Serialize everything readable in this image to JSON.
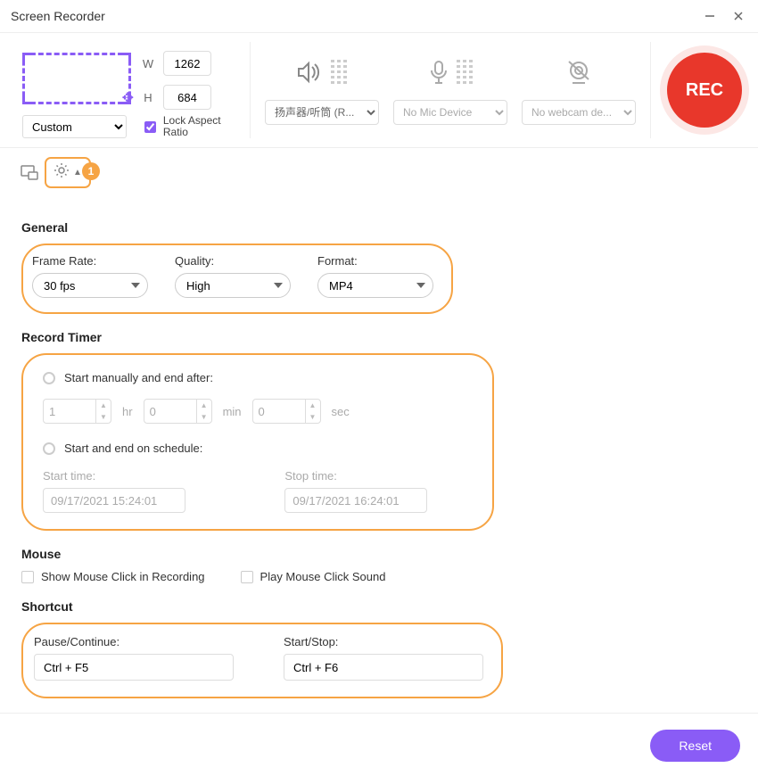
{
  "window": {
    "title": "Screen Recorder"
  },
  "region": {
    "w_label": "W",
    "h_label": "H",
    "width": "1262",
    "height": "684",
    "preset": "Custom",
    "lock_aspect": "Lock Aspect Ratio"
  },
  "sources": {
    "speaker_select": "扬声器/听筒 (R...",
    "mic_placeholder": "No Mic Device",
    "webcam_placeholder": "No webcam de..."
  },
  "rec_label": "REC",
  "gear_badge": "1",
  "sections": {
    "general": "General",
    "frame_rate_label": "Frame Rate:",
    "frame_rate": "30 fps",
    "quality_label": "Quality:",
    "quality": "High",
    "format_label": "Format:",
    "format": "MP4",
    "record_timer": "Record Timer",
    "start_manual": "Start manually and end after:",
    "hr_val": "1",
    "hr_unit": "hr",
    "min_val": "0",
    "min_unit": "min",
    "sec_val": "0",
    "sec_unit": "sec",
    "start_sched": "Start and end on schedule:",
    "start_time_label": "Start time:",
    "start_time": "09/17/2021 15:24:01",
    "stop_time_label": "Stop time:",
    "stop_time": "09/17/2021 16:24:01",
    "mouse": "Mouse",
    "show_click": "Show Mouse Click in Recording",
    "play_sound": "Play Mouse Click Sound",
    "shortcut": "Shortcut",
    "pause_label": "Pause/Continue:",
    "pause_key": "Ctrl + F5",
    "startstop_label": "Start/Stop:",
    "startstop_key": "Ctrl + F6"
  },
  "footer": {
    "reset": "Reset"
  }
}
